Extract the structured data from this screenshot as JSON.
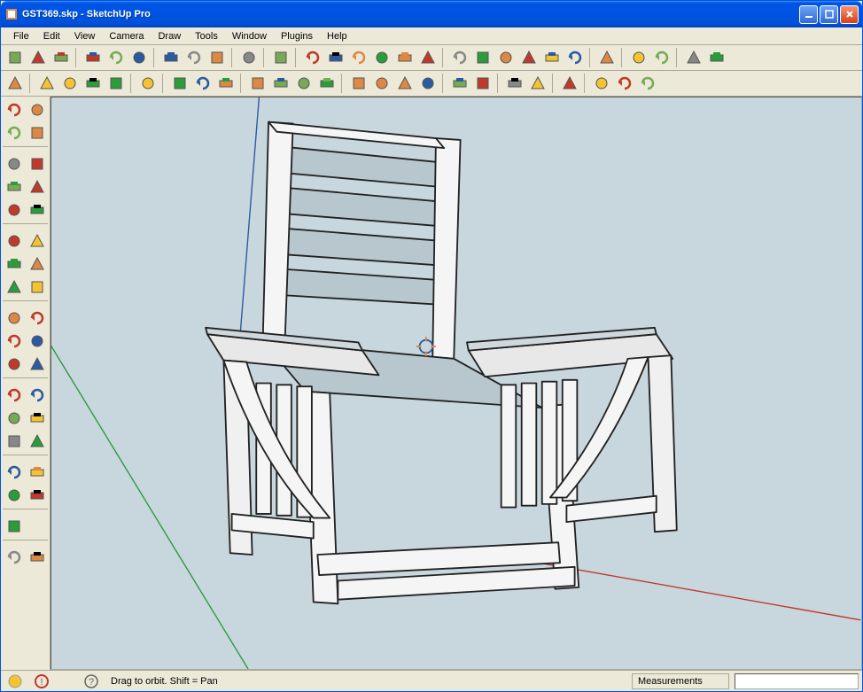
{
  "window": {
    "filename": "GST369.skp",
    "app_name": "SketchUp Pro"
  },
  "menu": {
    "items": [
      "File",
      "Edit",
      "View",
      "Camera",
      "Draw",
      "Tools",
      "Window",
      "Plugins",
      "Help"
    ]
  },
  "toolbar_top1": [
    {
      "name": "new-file-icon"
    },
    {
      "name": "open-file-icon"
    },
    {
      "name": "save-icon"
    },
    {
      "sep": true
    },
    {
      "name": "cut-icon"
    },
    {
      "name": "copy-icon"
    },
    {
      "name": "paste-icon"
    },
    {
      "sep": true
    },
    {
      "name": "erase-icon"
    },
    {
      "name": "undo-icon"
    },
    {
      "name": "redo-icon"
    },
    {
      "sep": true
    },
    {
      "name": "print-icon"
    },
    {
      "sep": true
    },
    {
      "name": "model-info-icon"
    },
    {
      "sep": true
    },
    {
      "name": "iso-icon"
    },
    {
      "name": "top-icon"
    },
    {
      "name": "front-icon"
    },
    {
      "name": "right-icon"
    },
    {
      "name": "back-icon"
    },
    {
      "name": "left-icon"
    },
    {
      "sep": true
    },
    {
      "name": "face-style1-icon"
    },
    {
      "name": "face-style2-icon"
    },
    {
      "name": "face-style3-icon"
    },
    {
      "name": "face-style4-icon"
    },
    {
      "name": "face-style5-icon"
    },
    {
      "name": "face-style6-icon"
    },
    {
      "sep": true
    },
    {
      "name": "xray-icon"
    },
    {
      "sep": true
    },
    {
      "name": "view-back-icon"
    },
    {
      "name": "view-forward-icon"
    },
    {
      "sep": true
    },
    {
      "name": "placeholder1-icon"
    },
    {
      "name": "placeholder2-icon"
    }
  ],
  "toolbar_top2": [
    {
      "name": "select-icon"
    },
    {
      "sep": true
    },
    {
      "name": "line-icon"
    },
    {
      "name": "rectangle-icon"
    },
    {
      "name": "circle-icon"
    },
    {
      "name": "arc-icon"
    },
    {
      "sep": true
    },
    {
      "name": "make-component-icon"
    },
    {
      "sep": true
    },
    {
      "name": "eraser-icon"
    },
    {
      "name": "tape-measure-icon"
    },
    {
      "name": "paint-bucket-icon"
    },
    {
      "sep": true
    },
    {
      "name": "push-pull-icon"
    },
    {
      "name": "move-icon"
    },
    {
      "name": "rotate-icon"
    },
    {
      "name": "offset-icon"
    },
    {
      "sep": true
    },
    {
      "name": "orbit-icon"
    },
    {
      "name": "pan-icon"
    },
    {
      "name": "zoom-icon"
    },
    {
      "name": "zoom-extents-icon"
    },
    {
      "sep": true
    },
    {
      "name": "get-models-icon"
    },
    {
      "name": "share-model-icon"
    },
    {
      "sep": true
    },
    {
      "name": "outliner-icon"
    },
    {
      "name": "component-icon"
    },
    {
      "sep": true
    },
    {
      "name": "google-earth-icon"
    },
    {
      "sep": true
    },
    {
      "name": "export-icon"
    },
    {
      "name": "upload-icon"
    },
    {
      "name": "building-icon"
    }
  ],
  "side_toolbar": [
    [
      "select-arrow-icon",
      "component-box-icon"
    ],
    [
      "paint-bucket2-icon",
      "eraser2-icon"
    ],
    "sep",
    [
      "rectangle2-icon",
      "line2-icon"
    ],
    [
      "circle2-icon",
      "arc2-icon"
    ],
    [
      "polygon-icon",
      "freehand-icon"
    ],
    "sep",
    [
      "move2-icon",
      "push-pull2-icon"
    ],
    [
      "rotate2-icon",
      "follow-me-icon"
    ],
    [
      "scale-icon",
      "offset2-icon"
    ],
    "sep",
    [
      "tape-measure2-icon",
      "dimension-icon"
    ],
    [
      "protractor-icon",
      "text-label-icon"
    ],
    [
      "axes-icon",
      "3d-text-icon"
    ],
    "sep",
    [
      "orbit2-icon",
      "pan2-icon"
    ],
    [
      "zoom2-icon",
      "zoom-window-icon"
    ],
    [
      "zoom-extents2-icon",
      "previous-icon"
    ],
    "sep",
    [
      "position-camera-icon",
      "look-around-icon"
    ],
    [
      "walk-icon",
      "section-plane-icon"
    ],
    "sep",
    [
      "layer-icon",
      null
    ],
    "sep",
    [
      "shadow-icon",
      "shadow-settings-icon"
    ]
  ],
  "statusbar": {
    "hint": "Drag to orbit.  Shift = Pan",
    "measurements_label": "Measurements",
    "measurements_value": ""
  },
  "colors": {
    "titlebar_blue": "#0054e3",
    "viewport_bg": "#c8d6de",
    "ui_bg": "#ece9d8"
  }
}
